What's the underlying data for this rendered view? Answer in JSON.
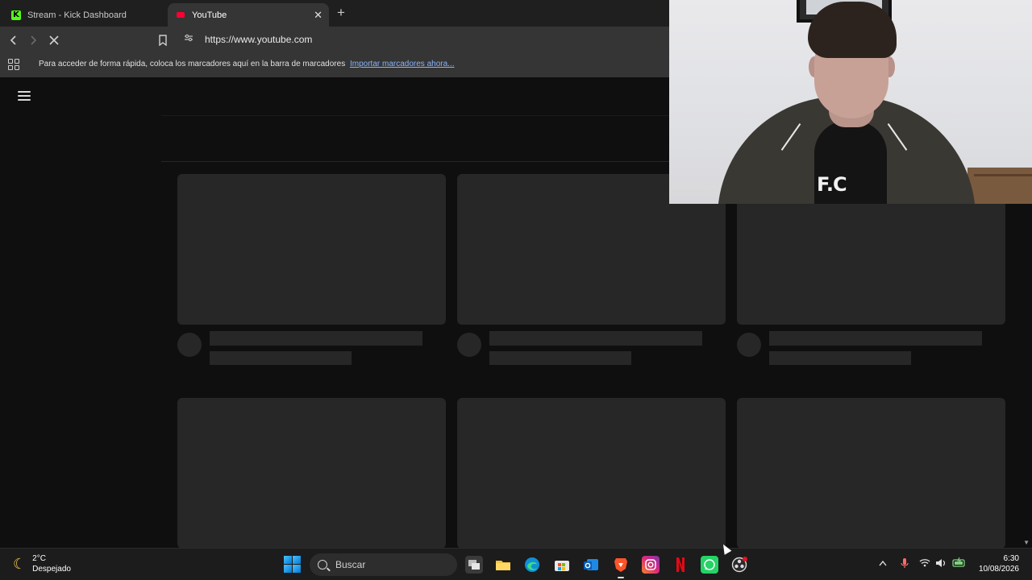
{
  "browser": {
    "tabs": [
      {
        "title": "Stream - Kick Dashboard",
        "favicon": "kick-icon",
        "active": false
      },
      {
        "title": "YouTube",
        "favicon": "youtube-icon",
        "active": true
      }
    ],
    "close_glyph": "✕",
    "new_tab_glyph": "+",
    "url": "https://www.youtube.com",
    "bookmarks_bar": {
      "message": "Para acceder de forma rápida, coloca los marcadores aquí en la barra de marcadores",
      "link": "Importar marcadores ahora..."
    }
  },
  "youtube": {
    "state": "loading-skeleton",
    "menu_icon": "hamburger-icon",
    "skeleton_cards": 6
  },
  "webcam": {
    "shirt_text": "F.C"
  },
  "taskbar": {
    "weather": {
      "temp": "2°C",
      "condition": "Despejado"
    },
    "search_placeholder": "Buscar",
    "clock": {
      "time": "6:30",
      "date": "10/08/2026"
    },
    "apps": [
      "task-view-icon",
      "file-explorer-icon",
      "edge-icon",
      "store-icon",
      "outlook-icon",
      "brave-icon",
      "instagram-icon",
      "netflix-icon",
      "whatsapp-icon",
      "obs-icon"
    ]
  },
  "colors": {
    "page_bg": "#0f0f0f",
    "skeleton": "#272727",
    "toolbar": "#353535",
    "link": "#8ab4f8"
  }
}
